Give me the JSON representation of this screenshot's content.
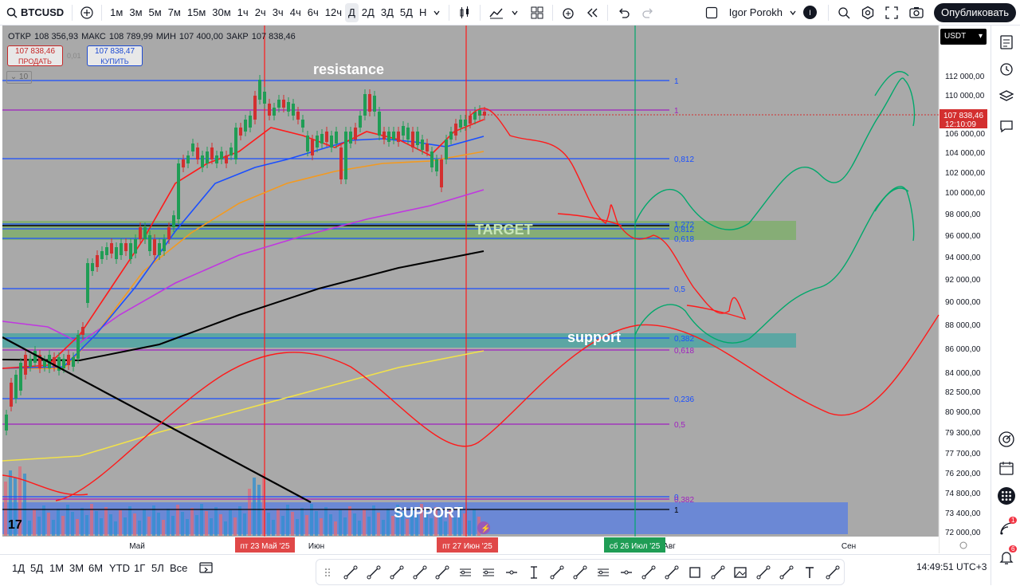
{
  "toolbar": {
    "symbol": "BTCUSD",
    "intervals": [
      "1м",
      "3м",
      "5м",
      "7м",
      "15м",
      "30м",
      "1ч",
      "2ч",
      "3ч",
      "4ч",
      "6ч",
      "12ч",
      "Д",
      "2Д",
      "3Д",
      "5Д",
      "Н"
    ],
    "active_interval": "Д",
    "user_name": "Igor Porokh",
    "user_initial": "I",
    "publish_label": "Опубликовать"
  },
  "legend": {
    "open_label": "ОТКР",
    "open": "108 356,93",
    "high_label": "МАКС",
    "high": "108 789,99",
    "low_label": "МИН",
    "low": "107 400,00",
    "close_label": "ЗАКР",
    "close": "107 838,46"
  },
  "trade": {
    "sell_price": "107 838,46",
    "sell_label": "ПРОДАТЬ",
    "spread": "0,01",
    "buy_price": "107 838,47",
    "buy_label": "КУПИТЬ",
    "collapse_count": "10"
  },
  "currency": "USDT",
  "price_axis": {
    "labels": [
      "112 000,00",
      "110 000,00",
      "108 000,00",
      "106 000,00",
      "104 000,00",
      "102 000,00",
      "100 000,00",
      "98 000,00",
      "96 000,00",
      "94 000,00",
      "92 000,00",
      "90 000,00",
      "88 000,00",
      "86 000,00",
      "84 000,00",
      "82 500,00",
      "80 900,00",
      "79 300,00",
      "77 700,00",
      "76 200,00",
      "74 800,00",
      "73 400,00",
      "72 000,00"
    ],
    "current_price": "107 838,46",
    "countdown": "12:10:09"
  },
  "time_axis": {
    "labels": [
      "Май",
      "Июн",
      "Авг",
      "Сен"
    ],
    "cursor_labels": [
      "пт 23 Май '25",
      "пт 27 Июн '25",
      "сб 26 Июл '25"
    ]
  },
  "annotations": {
    "resistance": "resistance",
    "target": "TARGET",
    "support": "support",
    "support_big": "SUPPORT"
  },
  "fib_labels": {
    "upper": [
      "1",
      "1",
      "0,812",
      "1,272",
      "0,812",
      "0,618",
      "0,5",
      "0,382",
      "0,618",
      "0,236",
      "0,5",
      "0",
      "0,382",
      "1"
    ]
  },
  "bottom": {
    "ranges": [
      "1Д",
      "5Д",
      "1М",
      "3М",
      "6М",
      "YTD",
      "1Г",
      "5Л",
      "Все"
    ],
    "time": "14:49:51 UTC+3"
  },
  "notifications": {
    "badge1": "1",
    "badge2": "6"
  },
  "colors": {
    "chart_bg": "#a9a9a9",
    "green_candle": "#26a69a",
    "red_candle": "#ef5350",
    "red_line": "#ff1a1a",
    "green_line": "#00a86b",
    "fib_blue": "#1a4fff",
    "fib_purple": "#a020c0",
    "accent": "#2962ff"
  }
}
